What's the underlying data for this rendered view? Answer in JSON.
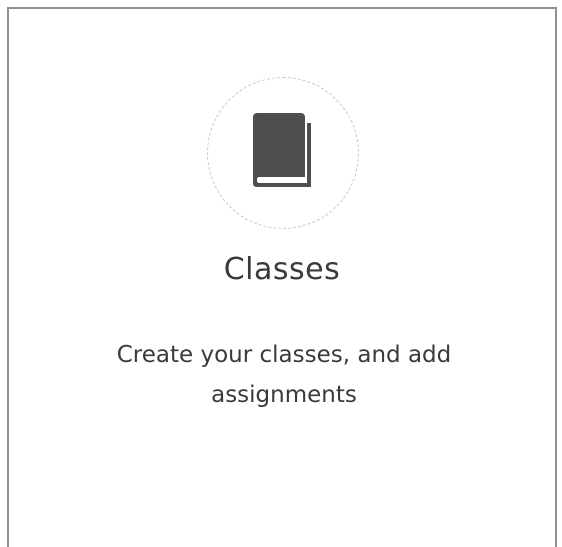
{
  "card": {
    "title": "Classes",
    "description": "Create your classes, and add assignments",
    "icon": "book-icon"
  },
  "colors": {
    "icon": "#4e4e4e",
    "text": "#3a3a3a",
    "border": "#8f8f8f",
    "circle": "#c8c8c8"
  }
}
